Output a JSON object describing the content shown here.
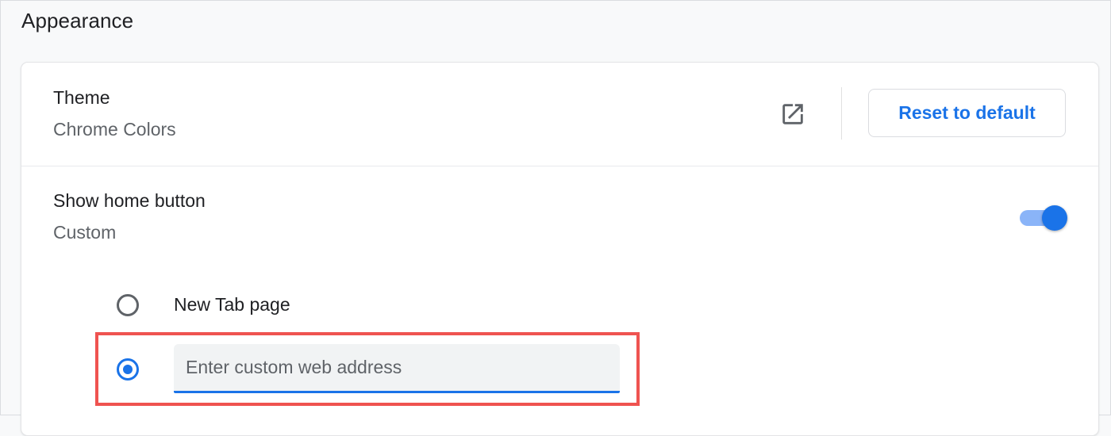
{
  "section": {
    "title": "Appearance"
  },
  "theme": {
    "title": "Theme",
    "value": "Chrome Colors",
    "external_icon": "open-in-new-icon",
    "reset_label": "Reset to default"
  },
  "home_button": {
    "title": "Show home button",
    "value": "Custom",
    "enabled": true,
    "options": [
      {
        "label": "New Tab page",
        "selected": false
      },
      {
        "label": "",
        "placeholder": "Enter custom web address",
        "selected": true
      }
    ]
  },
  "colors": {
    "accent": "#1a73e8",
    "toggle_track": "#8ab4f8",
    "highlight_box": "#ef5350",
    "secondary_text": "#5f6368"
  }
}
